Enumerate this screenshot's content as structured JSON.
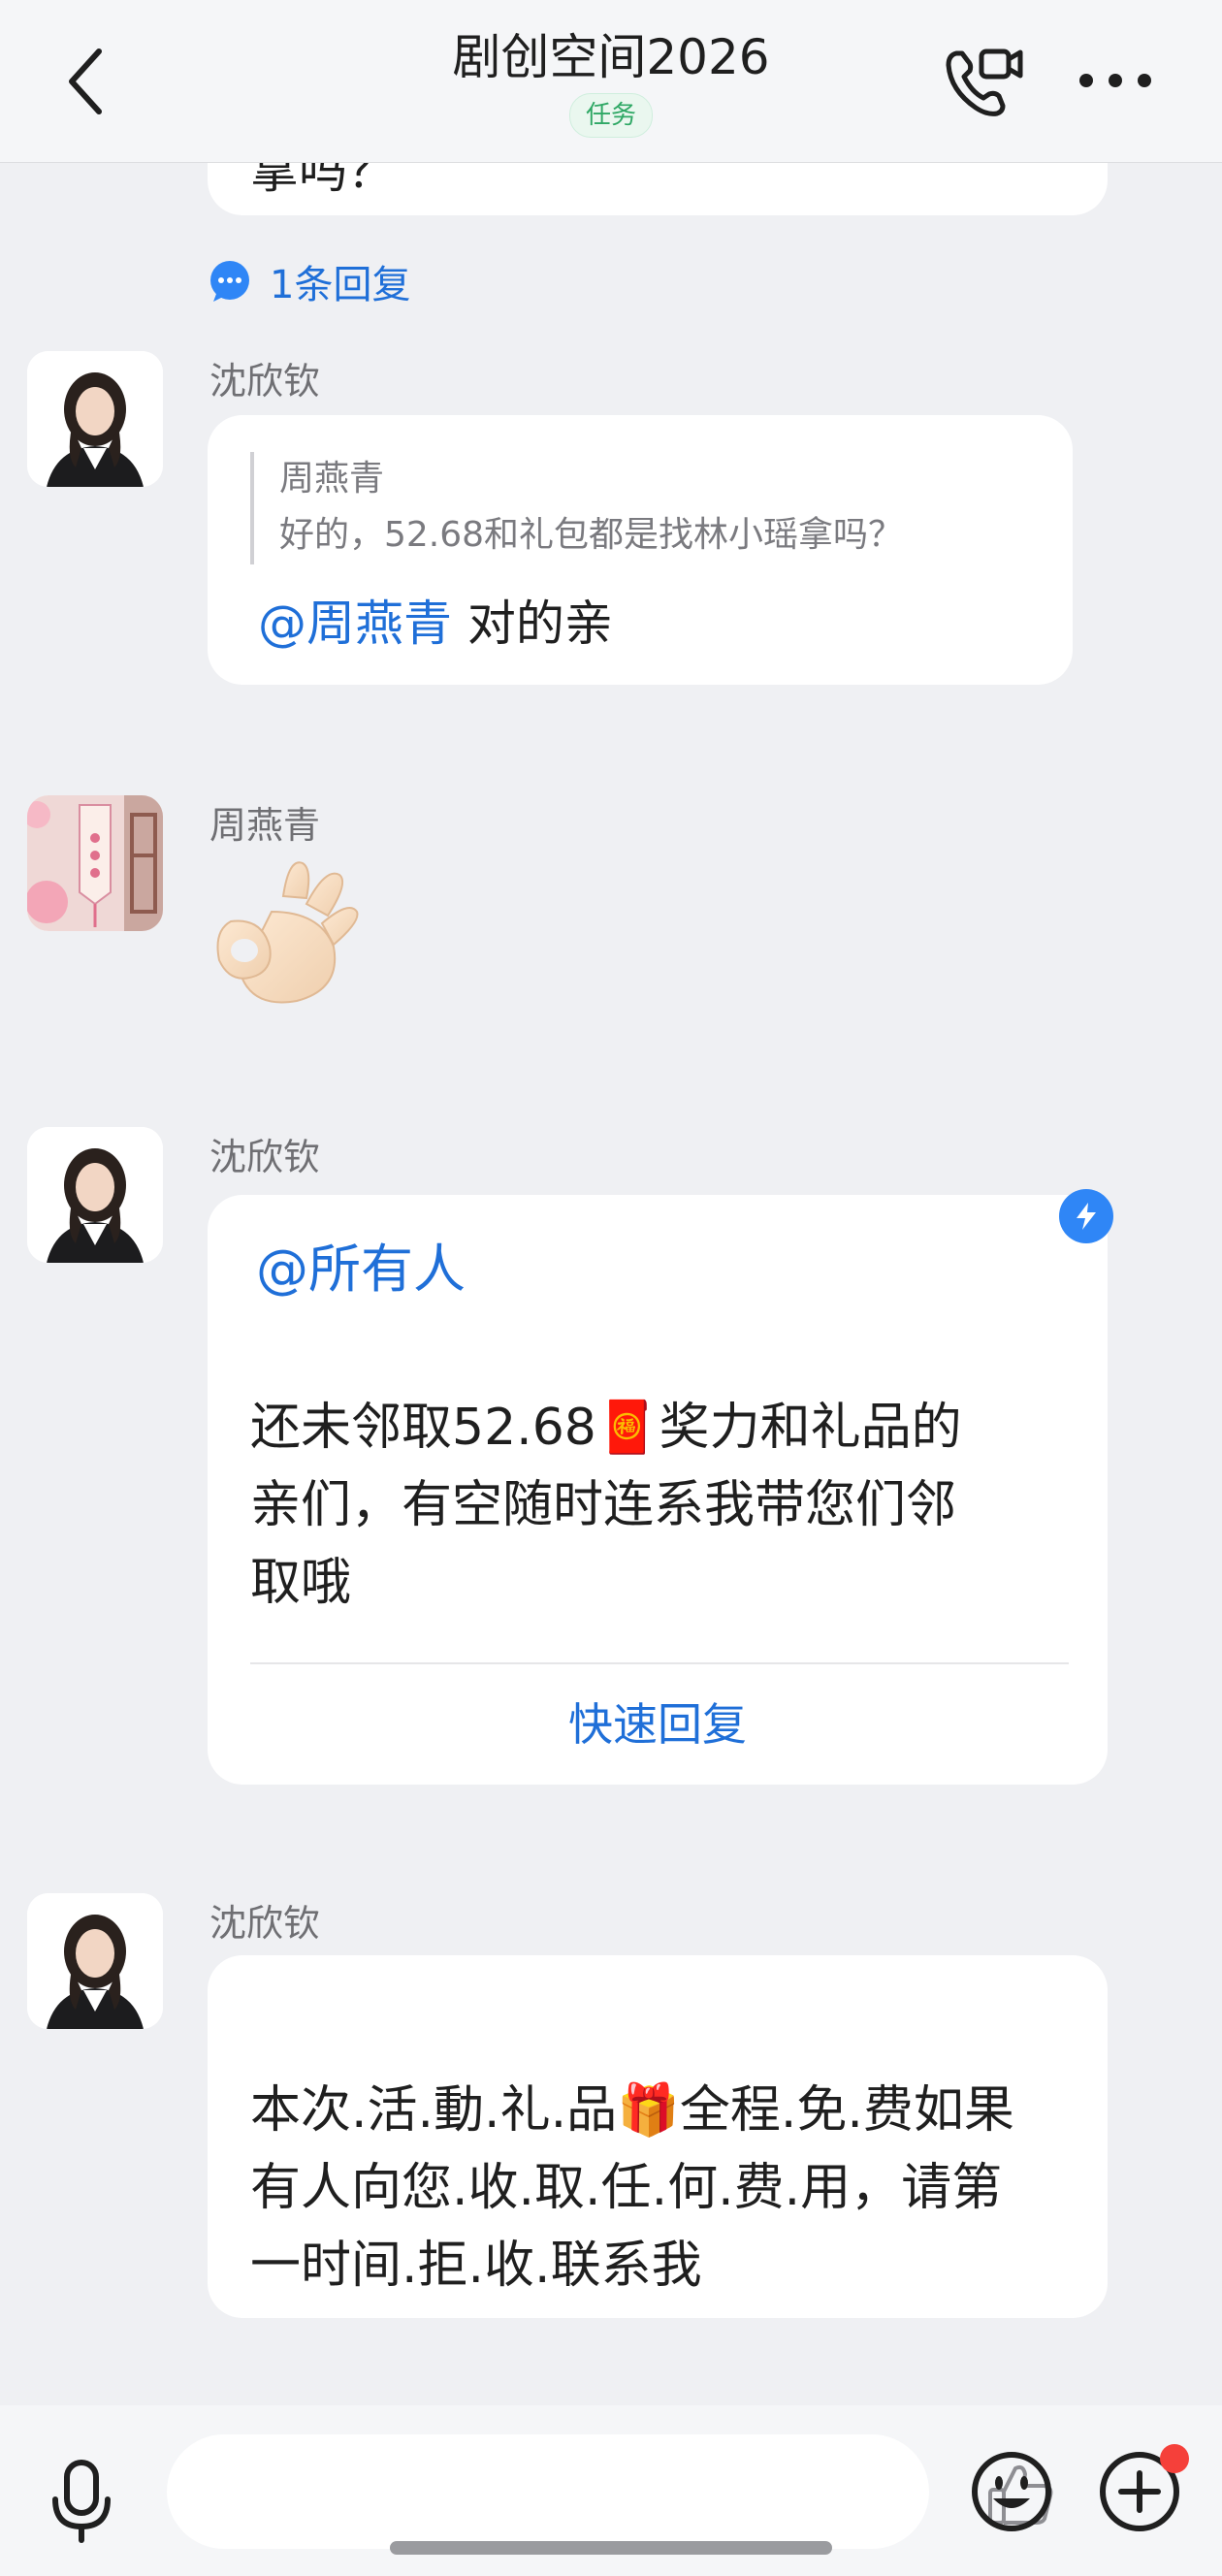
{
  "header": {
    "title": "剧创空间2026",
    "tag": "任务",
    "back_icon": "chevron-left-icon",
    "call_icon": "phone-video-icon",
    "more_icon": "more-dots-icon"
  },
  "messages": {
    "partial_text": "拿吗？",
    "reply_count_label": "1条回复",
    "msg1": {
      "sender": "沈欣钦",
      "quote_name": "周燕青",
      "quote_text": "好的，52.68和礼包都是找林小瑶拿吗？",
      "mention": "@周燕青",
      "text": " 对的亲"
    },
    "msg2": {
      "sender": "周燕青",
      "emoji": "ok-hand"
    },
    "msg3": {
      "sender": "沈欣钦",
      "mention": "@所有人",
      "line1": "还未邻取52.68🧧奖力和礼品的",
      "line2": "亲们，有空随时连系我带您们邻",
      "line3": "取哦",
      "quick_reply": "快速回复"
    },
    "msg4": {
      "sender": "沈欣钦",
      "line1": "本次.活.動.礼.品🎁全程.免.费如果",
      "line2": "有人向您.收.取.任.何.费.用，请第",
      "line3": "一时间.拒.收.联系我"
    }
  },
  "input_bar": {
    "placeholder": "",
    "icons": [
      "microphone-icon",
      "thumbs-up-icon",
      "emoji-icon",
      "plus-icon"
    ]
  },
  "colors": {
    "accent": "#1f6fd8",
    "tag_green": "#2fa865",
    "badge_red": "#f5403a"
  }
}
